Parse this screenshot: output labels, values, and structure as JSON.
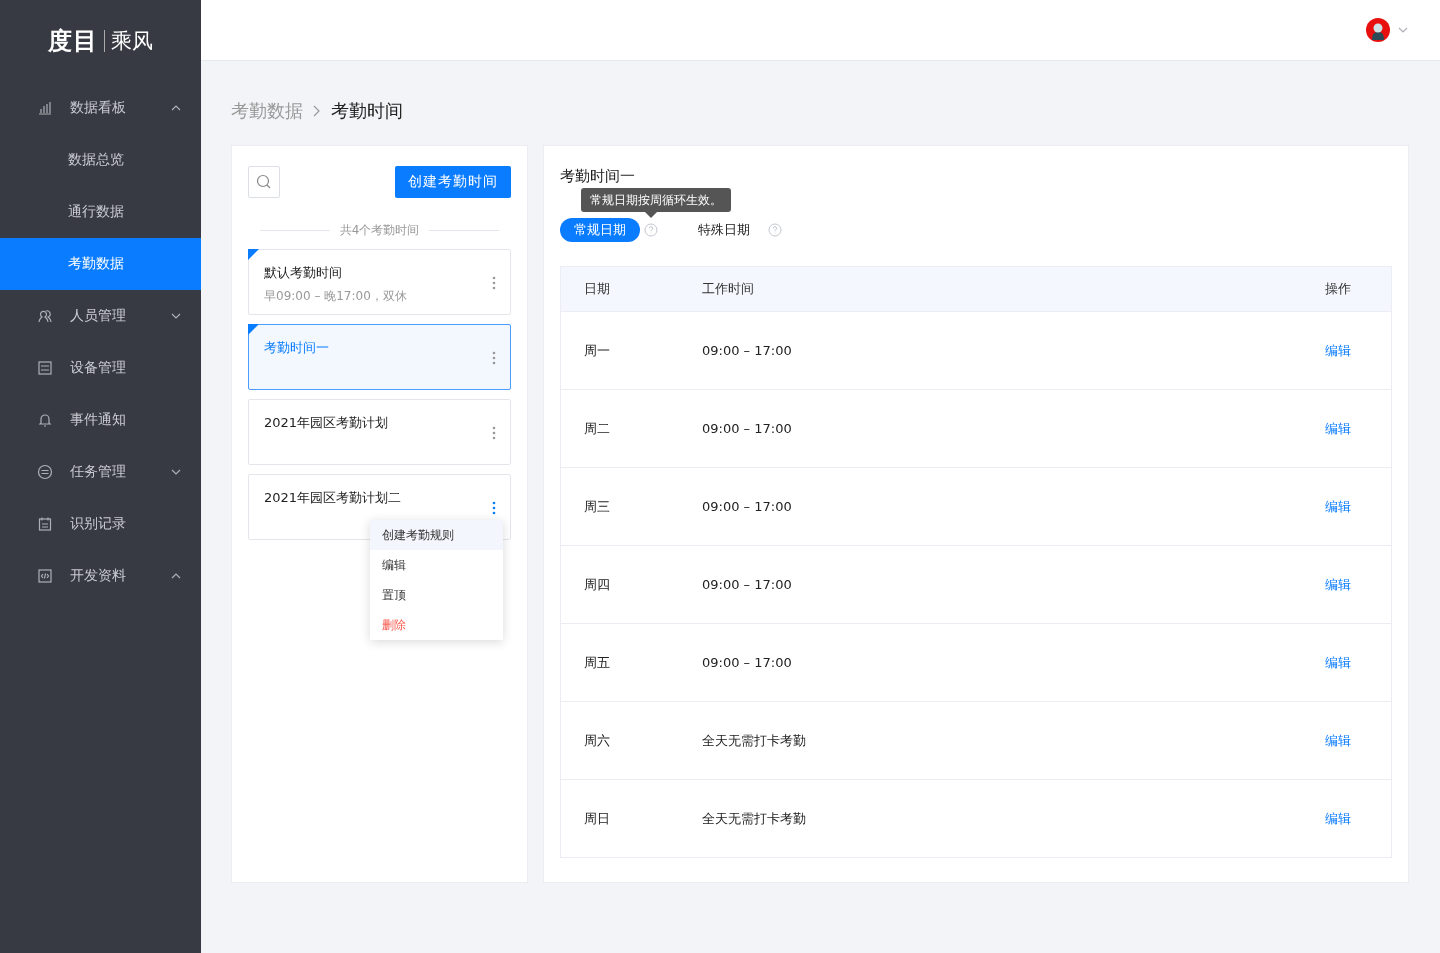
{
  "sidebar": {
    "logo": {
      "brand": "度目",
      "product": "乘风"
    },
    "items": [
      {
        "label": "数据看板",
        "expanded": true,
        "children": [
          {
            "label": "数据总览",
            "selected": false
          },
          {
            "label": "通行数据",
            "selected": false
          },
          {
            "label": "考勤数据",
            "selected": true
          }
        ]
      },
      {
        "label": "人员管理",
        "expanded": false
      },
      {
        "label": "设备管理"
      },
      {
        "label": "事件通知"
      },
      {
        "label": "任务管理",
        "expanded": false
      },
      {
        "label": "识别记录"
      },
      {
        "label": "开发资料",
        "expanded": true
      }
    ]
  },
  "breadcrumb": [
    "考勤数据",
    "考勤时间"
  ],
  "plans": {
    "create_button": "创建考勤时间",
    "count": "共4个考勤时间",
    "items": [
      {
        "title": "默认考勤时间",
        "subtitle": "早09:00 – 晚17:00，双休",
        "flagged": true,
        "selected": false,
        "menu_open": false
      },
      {
        "title": "考勤时间一",
        "flagged": true,
        "selected": true,
        "menu_open": false
      },
      {
        "title": "2021年园区考勤计划",
        "flagged": false,
        "selected": false,
        "menu_open": false
      },
      {
        "title": "2021年园区考勤计划二",
        "flagged": false,
        "selected": false,
        "menu_open": true,
        "menu": [
          {
            "label": "创建考勤规则",
            "kind": "normal",
            "selected": true
          },
          {
            "label": "编辑",
            "kind": "normal",
            "selected": false
          },
          {
            "label": "置顶",
            "kind": "normal",
            "selected": false
          },
          {
            "label": "删除",
            "kind": "danger",
            "selected": false
          }
        ]
      }
    ]
  },
  "detail": {
    "title": "考勤时间一",
    "tooltip": "常规日期按周循环生效。",
    "tabs": [
      {
        "label": "常规日期",
        "selected": true
      },
      {
        "label": "特殊日期",
        "selected": false
      }
    ],
    "table": {
      "columns": [
        "日期",
        "工作时间",
        "操作"
      ],
      "rows": [
        {
          "day": "周一",
          "time": "09:00 – 17:00",
          "action": "编辑"
        },
        {
          "day": "周二",
          "time": "09:00 – 17:00",
          "action": "编辑"
        },
        {
          "day": "周三",
          "time": "09:00 – 17:00",
          "action": "编辑"
        },
        {
          "day": "周四",
          "time": "09:00 – 17:00",
          "action": "编辑"
        },
        {
          "day": "周五",
          "time": "09:00 – 17:00",
          "action": "编辑"
        },
        {
          "day": "周六",
          "time": "全天无需打卡考勤",
          "action": "编辑"
        },
        {
          "day": "周日",
          "time": "全天无需打卡考勤",
          "action": "编辑"
        }
      ]
    }
  }
}
